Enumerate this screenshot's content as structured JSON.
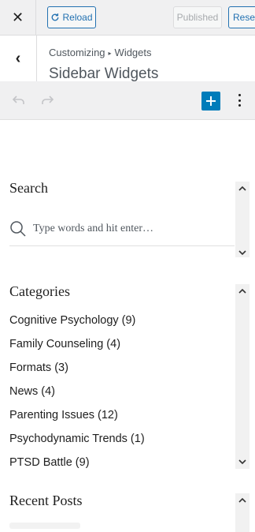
{
  "header": {
    "close_icon": "close-icon",
    "reload_label": "Reload",
    "published_label": "Published",
    "reset_label": "Reset"
  },
  "section": {
    "breadcrumb_parent": "Customizing",
    "breadcrumb_child": "Widgets",
    "title": "Sidebar Widgets"
  },
  "toolbar": {
    "undo_icon": "undo-icon",
    "redo_icon": "redo-icon",
    "add_icon": "plus-icon",
    "options_icon": "more-vertical-icon"
  },
  "widgets": {
    "search": {
      "title": "Search",
      "placeholder": "Type words and hit enter…"
    },
    "categories": {
      "title": "Categories",
      "items": [
        "Cognitive Psychology (9)",
        "Family Counseling (4)",
        "Formats (3)",
        "News (4)",
        "Parenting Issues (12)",
        "Psychodynamic Trends (1)",
        "PTSD Battle (9)"
      ]
    },
    "recent_posts": {
      "title": "Recent Posts"
    }
  },
  "colors": {
    "accent": "#2271b1",
    "add_button": "#007cba",
    "header_bg": "#f0f0f1"
  }
}
